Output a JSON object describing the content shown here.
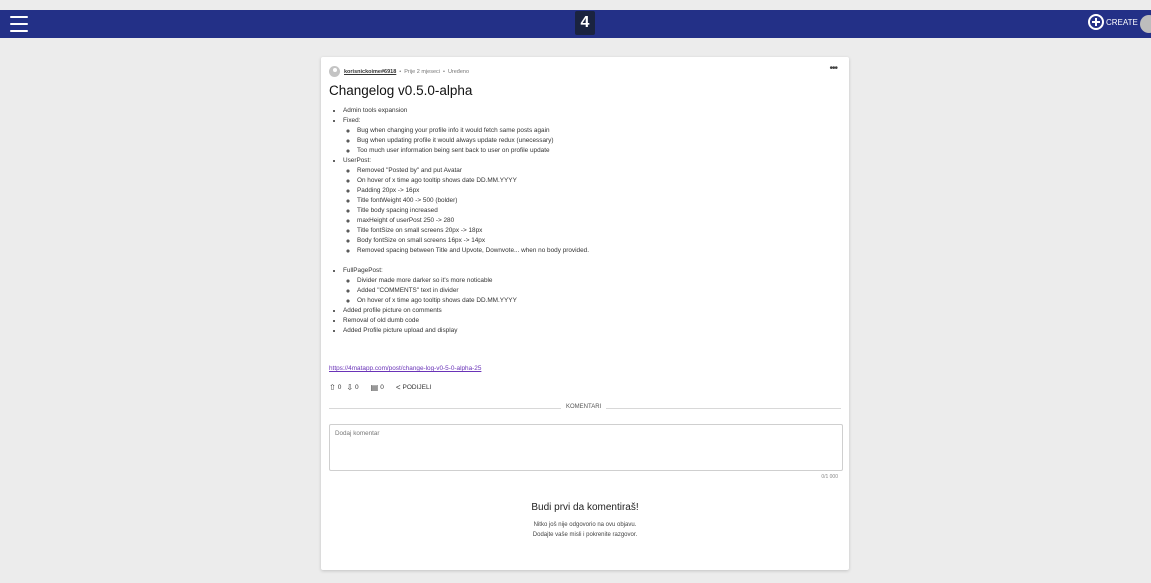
{
  "header": {
    "logo_text": "4",
    "create_label": "CREATE",
    "bar_color": "#233087"
  },
  "post": {
    "author": "korisnickoime#6918",
    "time": "Prije 2 mjeseci",
    "edited": "Uređeno",
    "more_label": "•••",
    "title": "Changelog v0.5.0-alpha",
    "items": {
      "admin": "Admin tools expansion",
      "fixed": "Fixed:",
      "fixed_sub": [
        "Bug when changing your profile info it would fetch same posts again",
        "Bug when updating profile it would always update redux (unecessary)",
        "Too much user information being sent back to user on profile update"
      ],
      "userpost": "UserPost:",
      "userpost_sub": [
        "Removed \"Posted by\" and put Avatar",
        "On hover of x time ago tooltip shows date DD.MM.YYYY",
        "Padding 20px -> 16px",
        "Title fontWeight 400 -> 500 (bolder)",
        "Title body spacing increased",
        "maxHeight of userPost 250 -> 280",
        "Title fontSize on small screens 20px -> 18px",
        "Body fontSize on small screens 16px -> 14px",
        "Removed spacing between Title and Upvote, Downvote... when no body provided."
      ],
      "fullpage": "FullPagePost:",
      "fullpage_sub": [
        "Divider made more darker so it's more noticable",
        "Added \"COMMENTS\" text in divider",
        "On hover of x time ago tooltip shows date DD.MM.YYYY"
      ],
      "tail": [
        "Added profile picture on comments",
        "Removal of old dumb code",
        "Added Profile picture upload and display"
      ]
    },
    "link": "https://4matapp.com/post/change-log-v0-5-0-alpha-25",
    "upvotes": "0",
    "downvotes": "0",
    "comments": "0",
    "share_label": "PODIJELI",
    "link_color": "#6a33b8"
  },
  "comments": {
    "divider_label": "KOMENTARI",
    "placeholder": "Dodaj komentar",
    "counter": "0/1 000",
    "empty_title": "Budi prvi da komentiraš!",
    "empty_line1": "Nitko još nije odgovorio na ovu objavu.",
    "empty_line2": "Dodajte vaše misli i pokrenite razgovor."
  }
}
